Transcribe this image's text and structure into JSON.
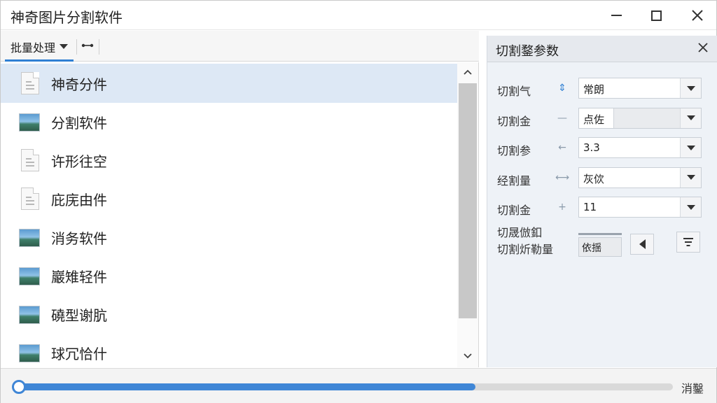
{
  "window": {
    "title": "神奇图片分割软件"
  },
  "toolbar": {
    "batch_label": "批量处理"
  },
  "files": [
    {
      "name": "神奇分件",
      "type": "doc",
      "selected": true
    },
    {
      "name": "分割软件",
      "type": "image",
      "selected": false
    },
    {
      "name": "许形往空",
      "type": "doc",
      "selected": false
    },
    {
      "name": "庇庑由件",
      "type": "doc",
      "selected": false
    },
    {
      "name": "消务软件",
      "type": "image",
      "selected": false
    },
    {
      "name": "巖雉轻件",
      "type": "image",
      "selected": false
    },
    {
      "name": "磽型谢肮",
      "type": "image",
      "selected": false
    },
    {
      "name": "球冗恰什",
      "type": "image",
      "selected": false
    }
  ],
  "panel": {
    "title": "切割鍪参数",
    "params": [
      {
        "label": "切割气",
        "value": "常朗",
        "icon": "arrows-vertical-icon"
      },
      {
        "label": "切割金",
        "value": "点佐",
        "icon": "dash-icon"
      },
      {
        "label": "切割参",
        "value": "3.3",
        "icon": "arrow-left-icon"
      },
      {
        "label": "经割量",
        "value": "灰佽",
        "icon": "link-icon"
      },
      {
        "label": "切割金",
        "value": "11",
        "icon": "plus-icon"
      }
    ],
    "extra_line1": "切晟倣釦",
    "extra_line2": "切割炘勒量",
    "extra_value": "依揺"
  },
  "status": {
    "progress": 0.7,
    "label": "消鑿"
  },
  "colors": {
    "accent": "#3f86d6",
    "selected_row": "#dde8f5",
    "panel_bg": "#eef2f7"
  }
}
